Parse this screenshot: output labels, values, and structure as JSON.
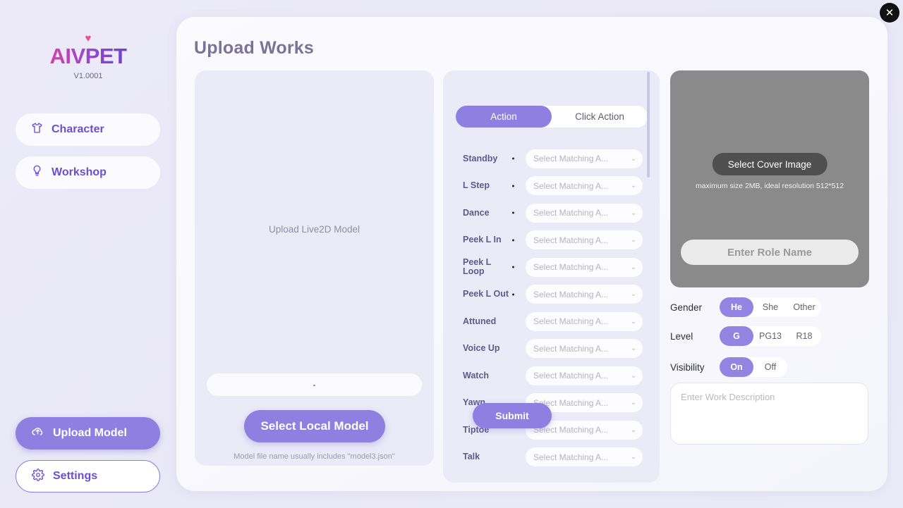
{
  "window": {
    "close_label": "✕"
  },
  "sidebar": {
    "logo": {
      "heart": "♥",
      "text": "AIVPET",
      "version": "V1.0001"
    },
    "items": [
      {
        "label": "Character",
        "icon": "tshirt-icon"
      },
      {
        "label": "Workshop",
        "icon": "lightbulb-icon"
      }
    ],
    "bottom_items": [
      {
        "label": "Upload Model",
        "icon": "cloud-upload-icon"
      },
      {
        "label": "Settings",
        "icon": "gear-icon"
      }
    ]
  },
  "main": {
    "title": "Upload Works",
    "model_panel": {
      "drop_label": "Upload Live2D Model",
      "path_value": "-",
      "select_button": "Select Local Model",
      "hint": "Model file name usually includes \"model3.json\""
    },
    "action_panel": {
      "tabs": [
        {
          "label": "Action",
          "active": true
        },
        {
          "label": "Click Action",
          "active": false
        }
      ],
      "select_placeholder": "Select Matching A...",
      "chevron": "⌄",
      "rows": [
        {
          "label": "Standby",
          "required": true
        },
        {
          "label": "L Step",
          "required": true
        },
        {
          "label": "Dance",
          "required": true
        },
        {
          "label": "Peek L In",
          "required": true
        },
        {
          "label": "Peek L Loop",
          "required": true
        },
        {
          "label": "Peek L Out",
          "required": true
        },
        {
          "label": "Attuned",
          "required": false
        },
        {
          "label": "Voice Up",
          "required": false
        },
        {
          "label": "Watch",
          "required": false
        },
        {
          "label": "Yawn",
          "required": false
        },
        {
          "label": "Tiptoe",
          "required": false
        },
        {
          "label": "Talk",
          "required": false
        }
      ]
    },
    "meta_panel": {
      "cover_button": "Select Cover Image",
      "cover_hint": "maximum size 2MB, ideal resolution 512*512",
      "role_name_placeholder": "Enter Role Name",
      "role_name_value": "",
      "gender": {
        "label": "Gender",
        "options": [
          "He",
          "She",
          "Other"
        ],
        "selected": "He"
      },
      "level": {
        "label": "Level",
        "options": [
          "G",
          "PG13",
          "R18"
        ],
        "selected": "G"
      },
      "visibility": {
        "label": "Visibility",
        "options": [
          "On",
          "Off"
        ],
        "selected": "On"
      },
      "description_placeholder": "Enter Work Description",
      "description_value": "",
      "submit_label": "Submit"
    }
  },
  "colors": {
    "accent": "#8f7fe0",
    "accent_soft": "#9384e2",
    "bg": "#ebeaf7",
    "panel": "#fbfbfe",
    "title": "#7b7299",
    "cover_bg": "#8a8a8a"
  }
}
